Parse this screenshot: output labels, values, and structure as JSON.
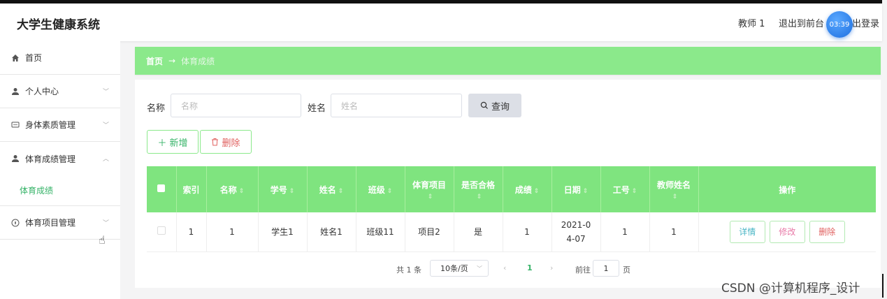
{
  "header": {
    "app_title": "大学生健康系统",
    "user_name": "教师 1",
    "front_link": "退出到前台",
    "logout_link": "出登录",
    "timer": "03:39"
  },
  "sidebar": {
    "items": [
      {
        "label": "首页",
        "icon": "home-icon"
      },
      {
        "label": "个人中心",
        "icon": "user-icon"
      },
      {
        "label": "身体素质管理",
        "icon": "chat-icon"
      },
      {
        "label": "体育成绩管理",
        "icon": "user-icon"
      },
      {
        "label": "体育项目管理",
        "icon": "compass-icon"
      }
    ],
    "active_sub": "体育成绩"
  },
  "breadcrumb": {
    "home": "首页",
    "separator": "→",
    "current": "体育成绩"
  },
  "search": {
    "name_label": "名称",
    "name_placeholder": "名称",
    "xingming_label": "姓名",
    "xingming_placeholder": "姓名",
    "button": "查询"
  },
  "actions": {
    "add": "新增",
    "delete": "删除"
  },
  "table": {
    "columns": [
      "索引",
      "名称",
      "学号",
      "姓名",
      "班级",
      "体育项目",
      "是否合格",
      "成绩",
      "日期",
      "工号",
      "教师姓名",
      "操作"
    ],
    "rows": [
      {
        "index": "1",
        "name": "1",
        "student_no": "学生1",
        "xingming": "姓名1",
        "class": "班级11",
        "project": "项目2",
        "qualified": "是",
        "score": "1",
        "date": "2021-04-07",
        "work_no": "1",
        "teacher": "1"
      }
    ],
    "row_actions": {
      "detail": "详情",
      "edit": "修改",
      "delete": "删除"
    }
  },
  "pager": {
    "total": "共 1 条",
    "page_size": "10条/页",
    "current_page": "1",
    "goto_label": "前往",
    "goto_value": "1",
    "page_suffix": "页"
  },
  "watermark": "CSDN @计算机程序_设计",
  "colors": {
    "accent_green": "#8be98b",
    "text_green": "#36b368",
    "danger": "#e0605f",
    "timer_blue": "#1d6fe0"
  }
}
